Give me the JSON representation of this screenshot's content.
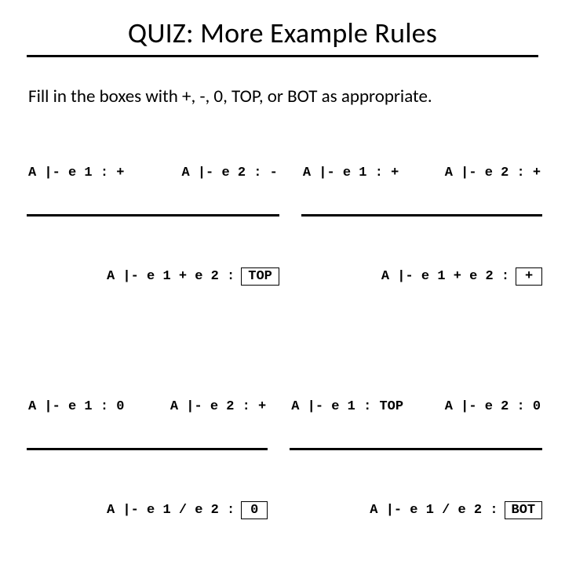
{
  "title": "QUIZ: More Example Rules",
  "prompt": "Fill in the boxes with +, -, 0, TOP, or BOT as appropriate.",
  "rules": [
    [
      {
        "p1": "A |- e 1 : +",
        "p2": "A |- e 2 : -",
        "concl": "A |- e 1 + e 2 :",
        "box": "TOP"
      },
      {
        "p1": "A |- e 1 : +",
        "p2": "A |- e 2 : +",
        "concl": "A |- e 1 + e 2 :",
        "box": "+"
      }
    ],
    [
      {
        "p1": "A |- e 1 : 0",
        "p2": "A |- e 2 : +",
        "concl": "A |- e 1 / e 2 :",
        "box": "0"
      },
      {
        "p1": "A |- e 1 : TOP",
        "p2": "A |- e 2 : 0",
        "concl": "A |- e 1 / e 2 :",
        "box": "BOT"
      }
    ]
  ]
}
